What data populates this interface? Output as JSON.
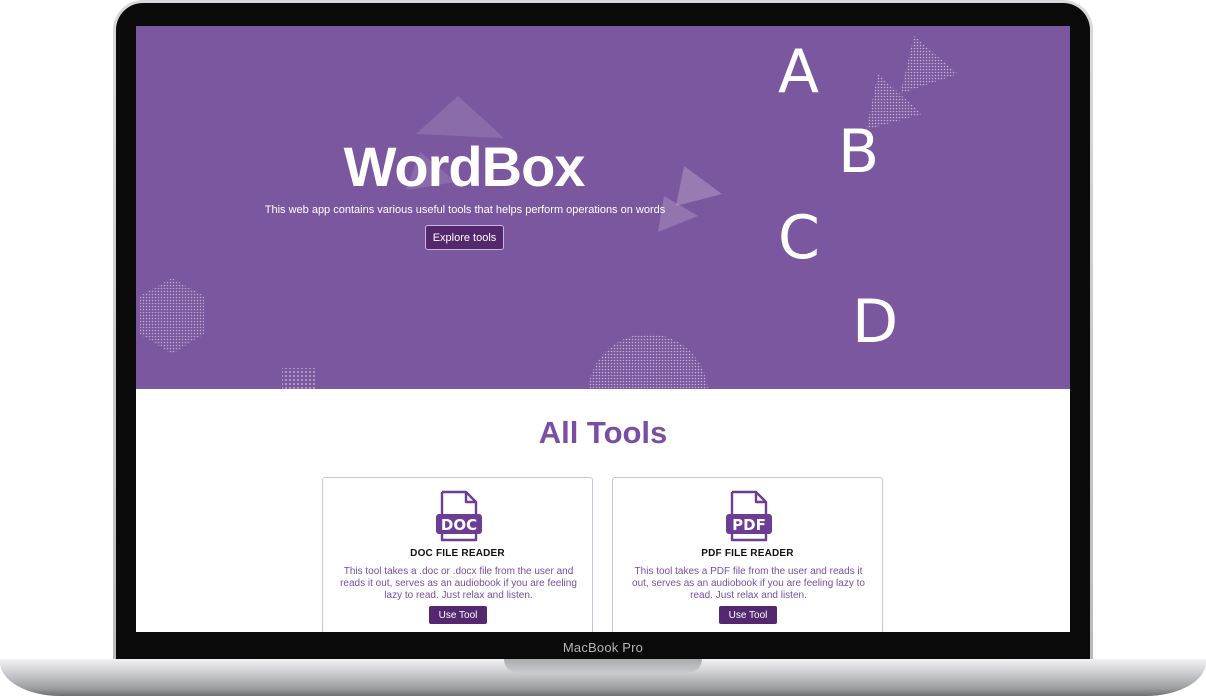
{
  "device": {
    "model": "MacBook Pro"
  },
  "hero": {
    "title": "WordBox",
    "subtitle": "This web app contains various useful tools that helps perform operations on words",
    "button_label": "Explore tools",
    "letters": [
      "A",
      "B",
      "C",
      "D"
    ]
  },
  "tools": {
    "heading": "All Tools",
    "cards": [
      {
        "icon_label": "DOC",
        "icon": "doc-file-icon",
        "title": "DOC FILE READER",
        "description": "This tool takes a .doc or .docx file from the user and reads it out, serves as an audiobook if you are feeling lazy to read. Just relax and listen.",
        "button_label": "Use Tool"
      },
      {
        "icon_label": "PDF",
        "icon": "pdf-file-icon",
        "title": "PDF FILE READER",
        "description": "This tool takes a PDF file from the user and reads it out, serves as an audiobook if you are feeling lazy to read. Just relax and listen.",
        "button_label": "Use Tool"
      }
    ]
  },
  "colors": {
    "hero_bg": "#7a579e",
    "accent": "#7a4ea3",
    "button_bg": "#54286f"
  }
}
